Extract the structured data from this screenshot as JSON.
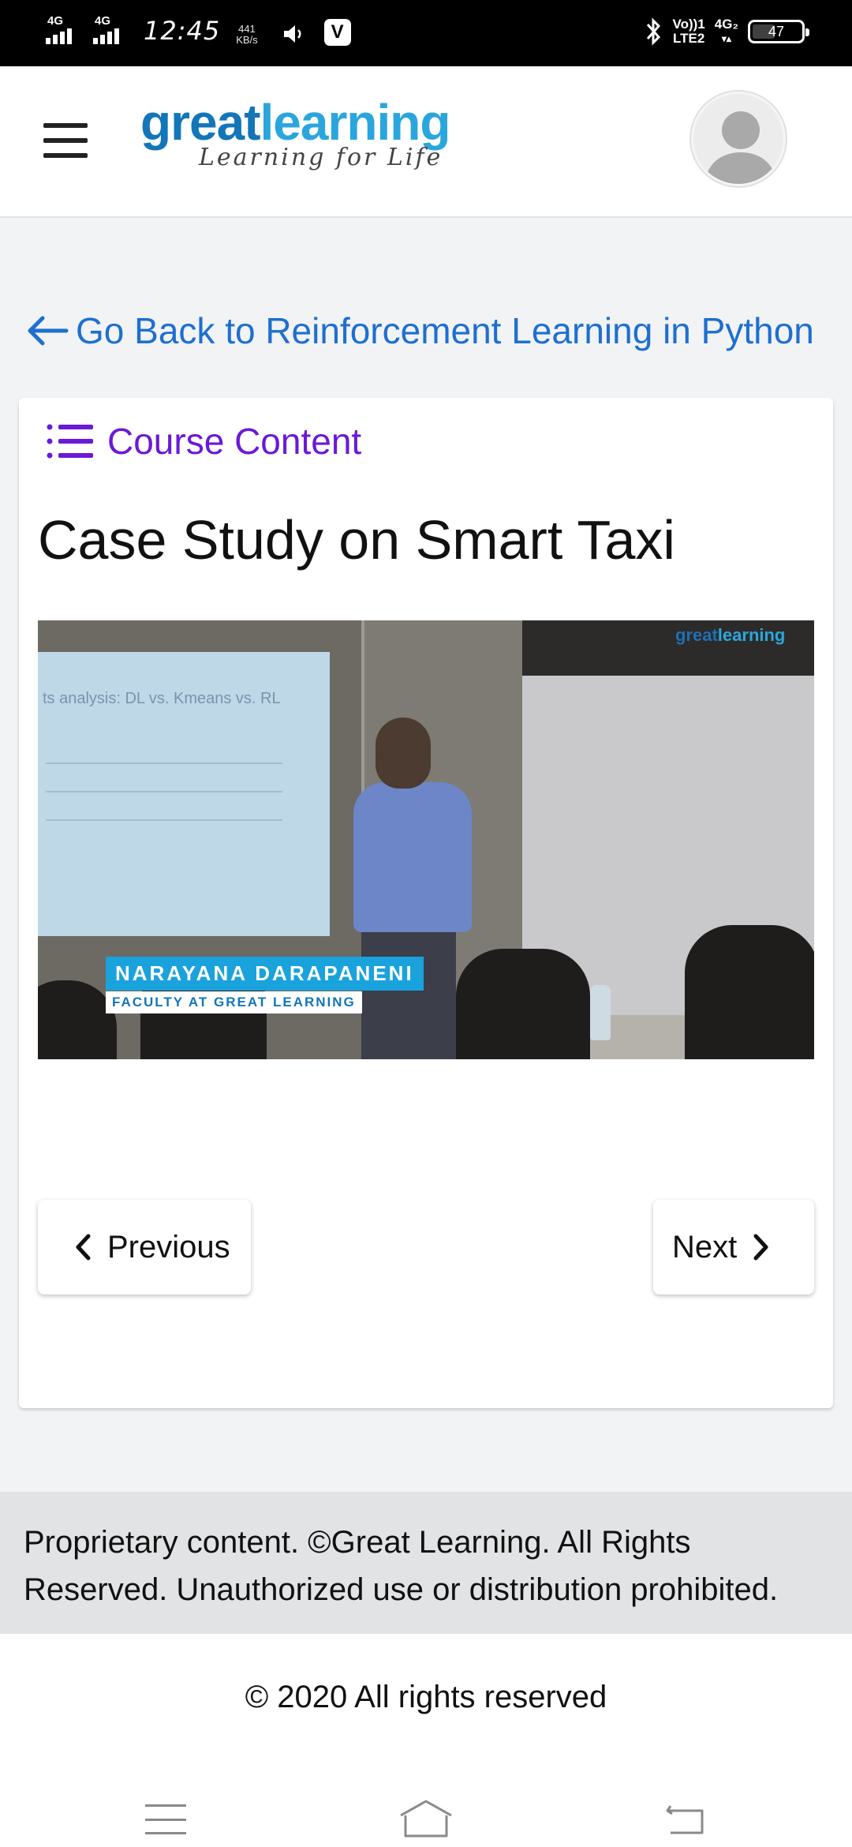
{
  "status_bar": {
    "network_1": "4G",
    "network_2": "4G",
    "time": "12:45",
    "speed_value": "441",
    "speed_unit": "KB/s",
    "volte_top": "Vo))1",
    "volte_bottom": "LTE2",
    "network_3": "4G₂",
    "battery": "47",
    "battery_level_percent": 47
  },
  "header": {
    "logo_part1": "great",
    "logo_part2": "learning",
    "logo_tagline": "Learning for Life",
    "colors": {
      "logo_dark": "#1276b9",
      "logo_light": "#2aa6dd"
    }
  },
  "back_link": {
    "label": "Go Back to Reinforcement Learning in Python",
    "color": "#1e6fd0"
  },
  "card": {
    "course_content_label": "Course Content",
    "course_content_color": "#6a19d8",
    "lesson_title": "Case Study on Smart Taxi",
    "video": {
      "screen_text": "ts analysis: DL vs. Kmeans vs. RL",
      "presenter_name": "NARAYANA DARAPANENI",
      "presenter_role": "FACULTY AT GREAT LEARNING",
      "watermark_part1": "great",
      "watermark_part2": "learning"
    },
    "previous_label": "Previous",
    "next_label": "Next"
  },
  "footer": {
    "disclaimer": "Proprietary content. ©Great Learning. All Rights Reserved. Unauthorized use or distribution prohibited.",
    "copyright": "© 2020 All rights reserved"
  },
  "system_nav": {
    "icons": [
      "menu-icon",
      "home-icon",
      "back-icon"
    ]
  }
}
